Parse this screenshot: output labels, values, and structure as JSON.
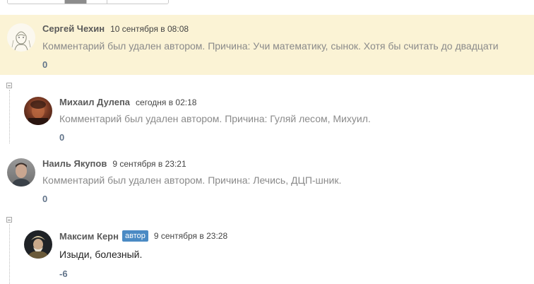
{
  "comments": [
    {
      "author": "Сергей Чехин",
      "date": "10 сентября в 08:08",
      "text": "Комментарий был удален автором. Причина: Учи математику, сынок. Хотя бы считать до двадцати",
      "score": "0"
    },
    {
      "author": "Михаил Дулепа",
      "date": "сегодня в 02:18",
      "text": "Комментарий был удален автором. Причина: Гуляй лесом, Михуил.",
      "score": "0"
    },
    {
      "author": "Наиль Якупов",
      "date": "9 сентября в 23:21",
      "text": "Комментарий был удален автором. Причина: Лечись, ДЦП-шник.",
      "score": "0"
    },
    {
      "author": "Максим Керн",
      "badge": "автор",
      "date": "9 сентября в 23:28",
      "text": "Изыди, болезный.",
      "score": "-6"
    }
  ],
  "colors": {
    "highlight_bg": "#fbf3d5",
    "badge_bg": "#4a8ac4",
    "score": "#62748a"
  }
}
